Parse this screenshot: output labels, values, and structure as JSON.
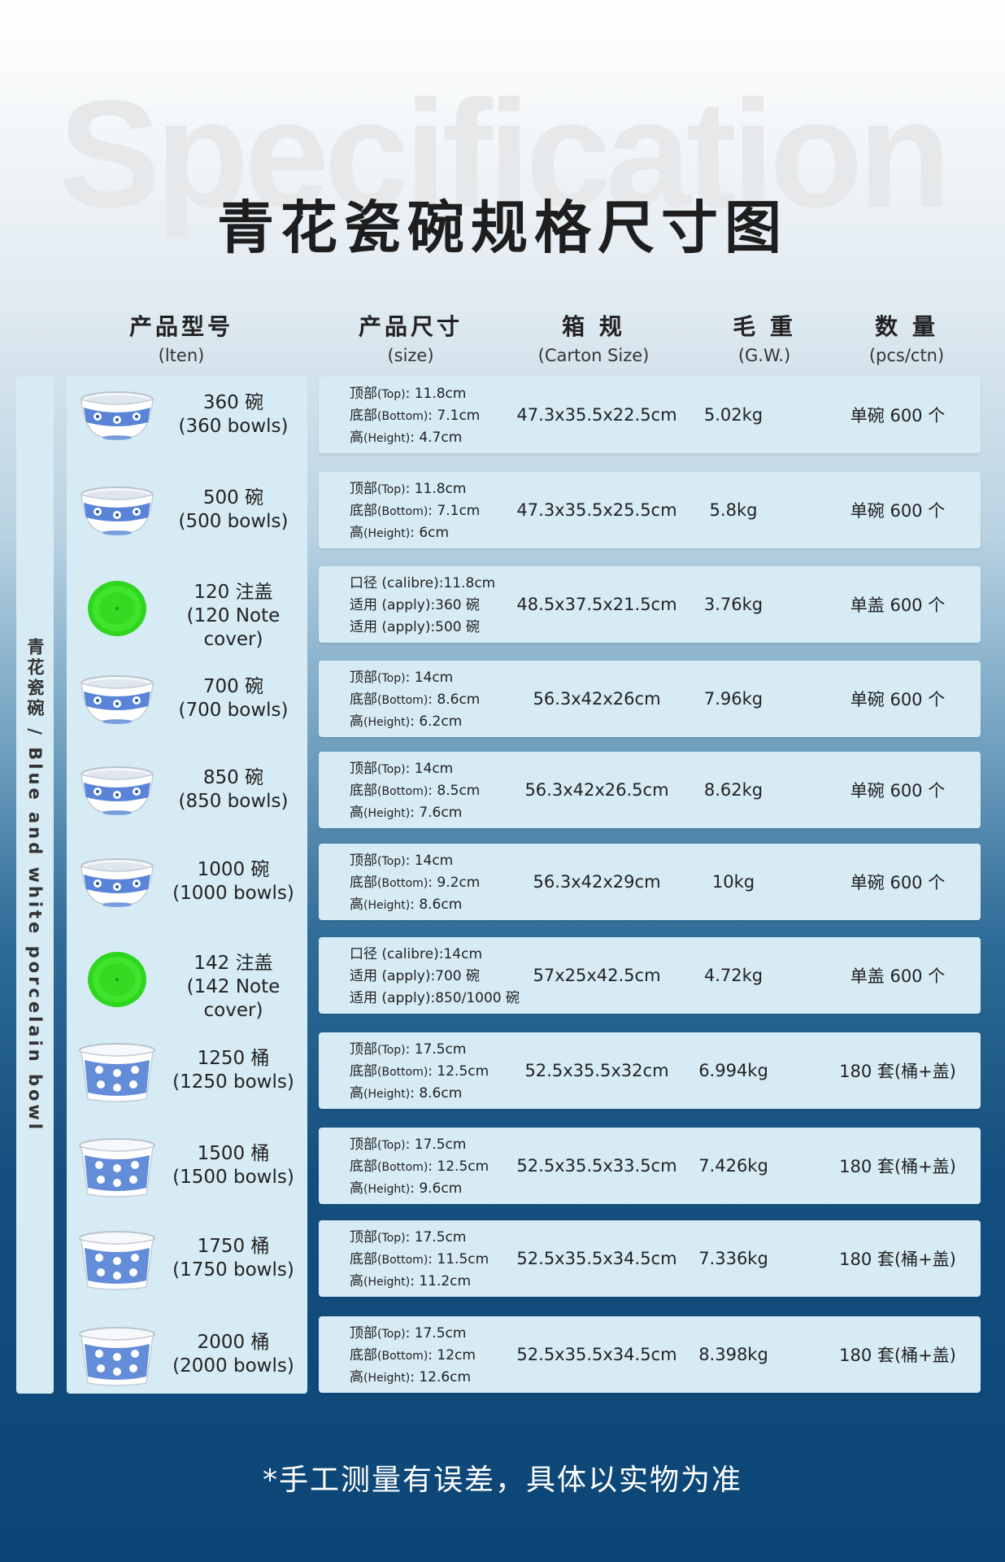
{
  "header": {
    "watermark": "Specification",
    "title": "青花瓷碗规格尺寸图"
  },
  "columns": [
    {
      "zh": "产品型号",
      "en": "(lten)"
    },
    {
      "zh": "产品尺寸",
      "en": "(size)"
    },
    {
      "zh": "箱 规",
      "en": "(Carton Size)"
    },
    {
      "zh": "毛 重",
      "en": "(G.W.)"
    },
    {
      "zh": "数 量",
      "en": "(pcs/ctn)"
    }
  ],
  "side_label": "青花瓷碗 / Blue and white porcelain bowl",
  "colors": {
    "bowl_blue": "#3c6fd0",
    "cover_green": "#2ed61f",
    "panel": "#d6ebf4"
  },
  "products": [
    {
      "icon": "bowl-icon",
      "name1": "360 碗",
      "name2": "(360 bowls)",
      "d1a": "顶部",
      "d1b": "(Top)",
      "d1c": ": 11.8cm",
      "d2a": "底部",
      "d2b": "(Bottom)",
      "d2c": ": 7.1cm",
      "d3a": "高",
      "d3b": "(Height)",
      "d3c": ": 4.7cm",
      "carton": "47.3x35.5x22.5cm",
      "weight": "5.02kg",
      "qty": "单碗 600 个"
    },
    {
      "icon": "bowl-icon",
      "name1": "500 碗",
      "name2": "(500 bowls)",
      "d1a": "顶部",
      "d1b": "(Top)",
      "d1c": ": 11.8cm",
      "d2a": "底部",
      "d2b": "(Bottom)",
      "d2c": ": 7.1cm",
      "d3a": "高",
      "d3b": "(Height)",
      "d3c": ": 6cm",
      "carton": "47.3x35.5x25.5cm",
      "weight": "5.8kg",
      "qty": "单碗 600 个"
    },
    {
      "icon": "lid-icon",
      "name1": "120 注盖",
      "name2": "(120 Note cover)",
      "d1a": "口径",
      "d1b": "",
      "d1c": " (calibre):11.8cm",
      "d2a": "适用",
      "d2b": "",
      "d2c": " (apply):360 碗",
      "d3a": "适用",
      "d3b": "",
      "d3c": " (apply):500 碗",
      "carton": "48.5x37.5x21.5cm",
      "weight": "3.76kg",
      "qty": "单盖 600 个"
    },
    {
      "icon": "bowl-icon",
      "name1": "700 碗",
      "name2": "(700 bowls)",
      "d1a": "顶部",
      "d1b": "(Top)",
      "d1c": ": 14cm",
      "d2a": "底部",
      "d2b": "(Bottom)",
      "d2c": ": 8.6cm",
      "d3a": "高",
      "d3b": "(Height)",
      "d3c": ": 6.2cm",
      "carton": "56.3x42x26cm",
      "weight": "7.96kg",
      "qty": "单碗 600 个"
    },
    {
      "icon": "bowl-icon",
      "name1": "850 碗",
      "name2": "(850 bowls)",
      "d1a": "顶部",
      "d1b": "(Top)",
      "d1c": ": 14cm",
      "d2a": "底部",
      "d2b": "(Bottom)",
      "d2c": ": 8.5cm",
      "d3a": "高",
      "d3b": "(Height)",
      "d3c": ": 7.6cm",
      "carton": "56.3x42x26.5cm",
      "weight": "8.62kg",
      "qty": "单碗 600 个"
    },
    {
      "icon": "bowl-icon",
      "name1": "1000 碗",
      "name2": "(1000 bowls)",
      "d1a": "顶部",
      "d1b": "(Top)",
      "d1c": ": 14cm",
      "d2a": "底部",
      "d2b": "(Bottom)",
      "d2c": ": 9.2cm",
      "d3a": "高",
      "d3b": "(Height)",
      "d3c": ": 8.6cm",
      "carton": "56.3x42x29cm",
      "weight": "10kg",
      "qty": "单碗 600 个"
    },
    {
      "icon": "lid-icon",
      "name1": "142 注盖",
      "name2": "(142 Note cover)",
      "d1a": "口径",
      "d1b": "",
      "d1c": " (calibre):14cm",
      "d2a": "适用",
      "d2b": "",
      "d2c": " (apply):700 碗",
      "d3a": "适用",
      "d3b": "",
      "d3c": " (apply):850/1000 碗",
      "carton": "57x25x42.5cm",
      "weight": "4.72kg",
      "qty": "单盖 600 个"
    },
    {
      "icon": "bucket-icon",
      "name1": "1250 桶",
      "name2": "(1250 bowls)",
      "d1a": "顶部",
      "d1b": "(Top)",
      "d1c": ": 17.5cm",
      "d2a": "底部",
      "d2b": "(Bottom)",
      "d2c": ": 12.5cm",
      "d3a": "高",
      "d3b": "(Height)",
      "d3c": ": 8.6cm",
      "carton": "52.5x35.5x32cm",
      "weight": "6.994kg",
      "qty": "180 套(桶+盖)"
    },
    {
      "icon": "bucket-icon",
      "name1": "1500 桶",
      "name2": "(1500 bowls)",
      "d1a": "顶部",
      "d1b": "(Top)",
      "d1c": ": 17.5cm",
      "d2a": "底部",
      "d2b": "(Bottom)",
      "d2c": ": 12.5cm",
      "d3a": "高",
      "d3b": "(Height)",
      "d3c": ": 9.6cm",
      "carton": "52.5x35.5x33.5cm",
      "weight": "7.426kg",
      "qty": "180 套(桶+盖)"
    },
    {
      "icon": "bucket-icon",
      "name1": "1750 桶",
      "name2": "(1750 bowls)",
      "d1a": "顶部",
      "d1b": "(Top)",
      "d1c": ": 17.5cm",
      "d2a": "底部",
      "d2b": "(Bottom)",
      "d2c": ": 11.5cm",
      "d3a": "高",
      "d3b": "(Height)",
      "d3c": ": 11.2cm",
      "carton": "52.5x35.5x34.5cm",
      "weight": "7.336kg",
      "qty": "180 套(桶+盖)"
    },
    {
      "icon": "bucket-icon",
      "name1": "2000 桶",
      "name2": "(2000 bowls)",
      "d1a": "顶部",
      "d1b": "(Top)",
      "d1c": ": 17.5cm",
      "d2a": "底部",
      "d2b": "(Bottom)",
      "d2c": ": 12cm",
      "d3a": "高",
      "d3b": "(Height)",
      "d3c": ": 12.6cm",
      "carton": "52.5x35.5x34.5cm",
      "weight": "8.398kg",
      "qty": "180 套(桶+盖)"
    }
  ],
  "footer_note": "*手工测量有误差，具体以实物为准"
}
